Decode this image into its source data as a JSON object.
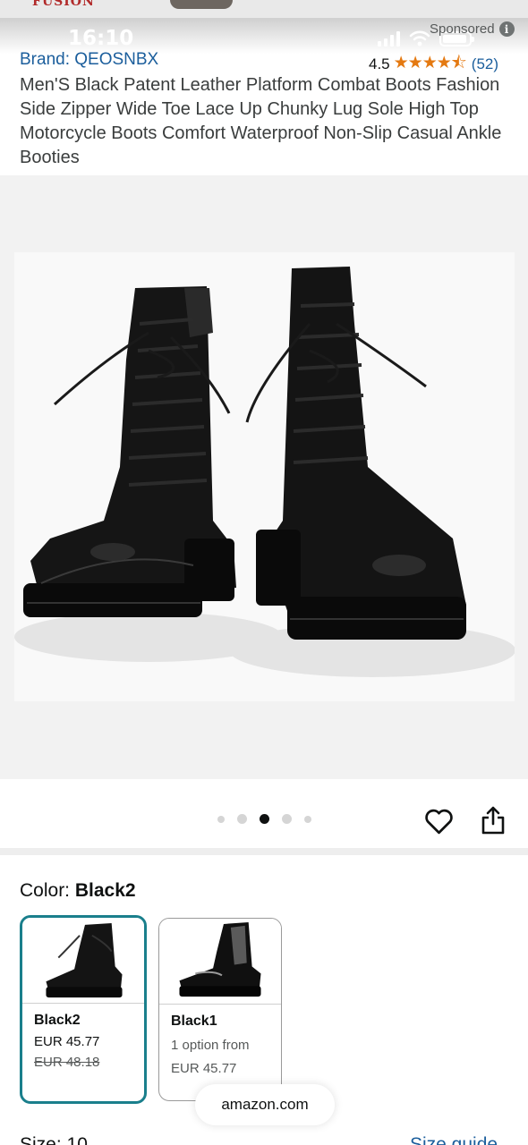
{
  "status_bar": {
    "time": "16:10"
  },
  "top_banner": {
    "logo_fragment": "FUSION"
  },
  "sponsored": {
    "label": "Sponsored",
    "info_icon": "i"
  },
  "product": {
    "brand": "Brand: QEOSNBX",
    "rating_value": "4.5",
    "stars": "★★★★⯪",
    "review_count": "(52)",
    "title": "Men'S Black Patent Leather Platform Combat Boots Fashion Side Zipper Wide Toe Lace Up Chunky Lug Sole High Top Motorcycle Boots Comfort Waterproof Non-Slip Casual Ankle Booties"
  },
  "gallery": {
    "image_count": 5,
    "active_index": 2
  },
  "color": {
    "label": "Color: ",
    "selected": "Black2",
    "options": [
      {
        "name": "Black2",
        "price": "EUR 45.77",
        "list_price": "EUR 48.18"
      },
      {
        "name": "Black1",
        "note": "1 option from",
        "price": "EUR 45.77"
      }
    ]
  },
  "browser": {
    "url": "amazon.com"
  },
  "size": {
    "label": "Size: 10",
    "guide": "Size guide"
  },
  "colors": {
    "link": "#1b5e9c",
    "star": "#e47911",
    "selected_border": "#1a7f8c"
  }
}
